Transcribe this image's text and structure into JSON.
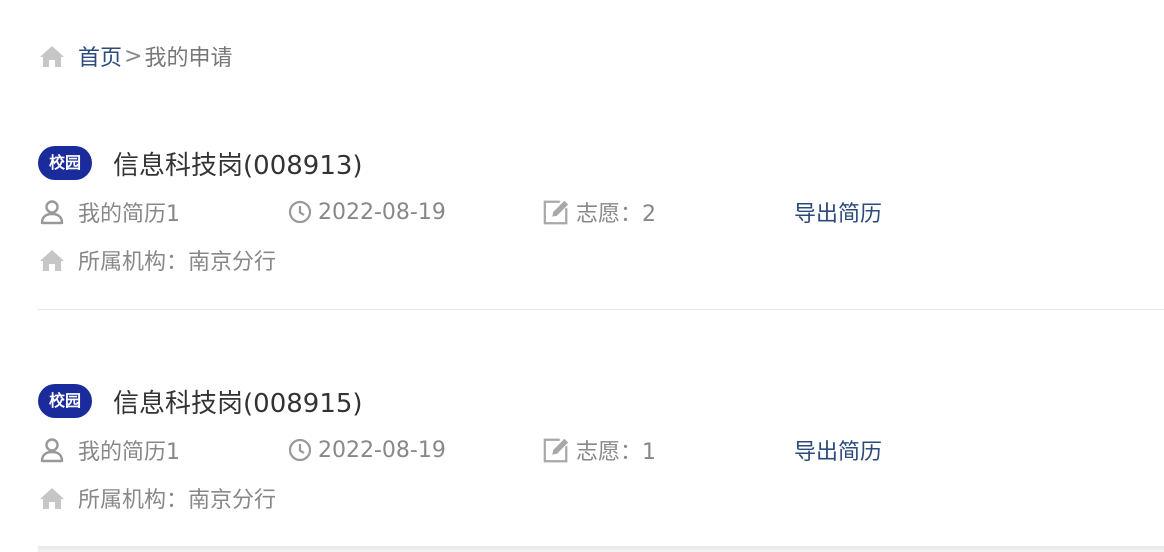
{
  "breadcrumb": {
    "home_label": "首页",
    "separator": ">",
    "current_label": "我的申请"
  },
  "colors": {
    "tag_bg": "#1a2b9c",
    "link": "#2c4a7a",
    "muted_text": "#888888",
    "title_text": "#333333"
  },
  "applications": [
    {
      "tag": "校园",
      "title": "信息科技岗(008913)",
      "resume": "我的简历1",
      "date": "2022-08-19",
      "choice": "志愿：2",
      "export_label": "导出简历",
      "org": "所属机构：南京分行"
    },
    {
      "tag": "校园",
      "title": "信息科技岗(008915)",
      "resume": "我的简历1",
      "date": "2022-08-19",
      "choice": "志愿：1",
      "export_label": "导出简历",
      "org": "所属机构：南京分行"
    }
  ],
  "icons": {
    "home": "home-icon",
    "user": "user-icon",
    "clock": "clock-icon",
    "edit": "edit-icon"
  }
}
